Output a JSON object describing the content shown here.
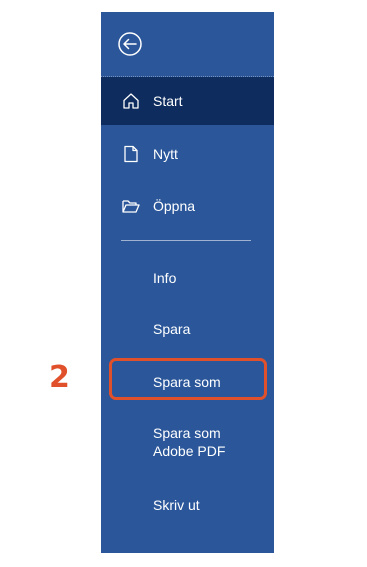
{
  "backstage": {
    "back_icon": "back-arrow-icon",
    "nav": {
      "start": {
        "label": "Start",
        "icon": "home-icon"
      },
      "new": {
        "label": "Nytt",
        "icon": "new-document-icon"
      },
      "open": {
        "label": "Öppna",
        "icon": "open-folder-icon"
      }
    },
    "items": {
      "info": "Info",
      "save": "Spara",
      "save_as": "Spara som",
      "save_as_pdf_line1": "Spara som",
      "save_as_pdf_line2": "Adobe PDF",
      "print": "Skriv ut"
    }
  },
  "annotation": {
    "step_number": "2",
    "color": "#e0512b"
  },
  "colors": {
    "backstage_bg": "#2b579a",
    "active_bg": "#0e2d5e"
  }
}
